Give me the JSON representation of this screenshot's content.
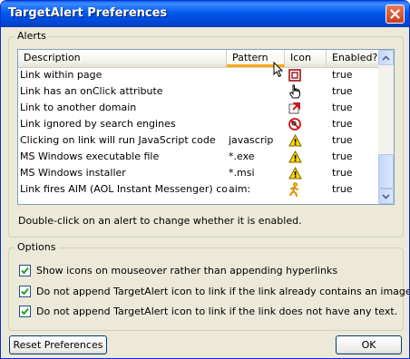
{
  "window": {
    "title": "TargetAlert Preferences"
  },
  "alerts": {
    "legend": "Alerts",
    "columns": {
      "description": "Description",
      "pattern": "Pattern",
      "icon": "Icon",
      "enabled": "Enabled?"
    },
    "rows": [
      {
        "description": "Link within page",
        "pattern": "",
        "icon": "in-page-link-icon",
        "enabled": "true"
      },
      {
        "description": "Link has an onClick attribute",
        "pattern": "",
        "icon": "hand-cursor-icon",
        "enabled": "true"
      },
      {
        "description": "Link to another domain",
        "pattern": "",
        "icon": "external-arrow-icon",
        "enabled": "true"
      },
      {
        "description": "Link ignored by search engines",
        "pattern": "",
        "icon": "no-search-icon",
        "enabled": "true"
      },
      {
        "description": "Clicking on link will run JavaScript code",
        "pattern": "javascript:",
        "icon": "warning-icon",
        "enabled": "true"
      },
      {
        "description": "MS Windows executable file",
        "pattern": "*.exe",
        "icon": "warning-icon",
        "enabled": "true"
      },
      {
        "description": "MS Windows installer",
        "pattern": "*.msi",
        "icon": "warning-icon",
        "enabled": "true"
      },
      {
        "description": "Link fires AIM (AOL Instant Messenger) co...",
        "pattern": "aim:",
        "icon": "aim-running-man-icon",
        "enabled": "true"
      }
    ],
    "hint": "Double-click on an alert to change whether it is enabled."
  },
  "options": {
    "legend": "Options",
    "items": [
      {
        "label": "Show icons on mouseover rather than appending hyperlinks",
        "checked": true
      },
      {
        "label": "Do not append TargetAlert icon to link if the link already contains an image.",
        "checked": true
      },
      {
        "label": "Do not append TargetAlert icon to link if the link does not have any text.",
        "checked": true
      }
    ]
  },
  "buttons": {
    "reset": "Reset Preferences",
    "ok": "OK"
  }
}
